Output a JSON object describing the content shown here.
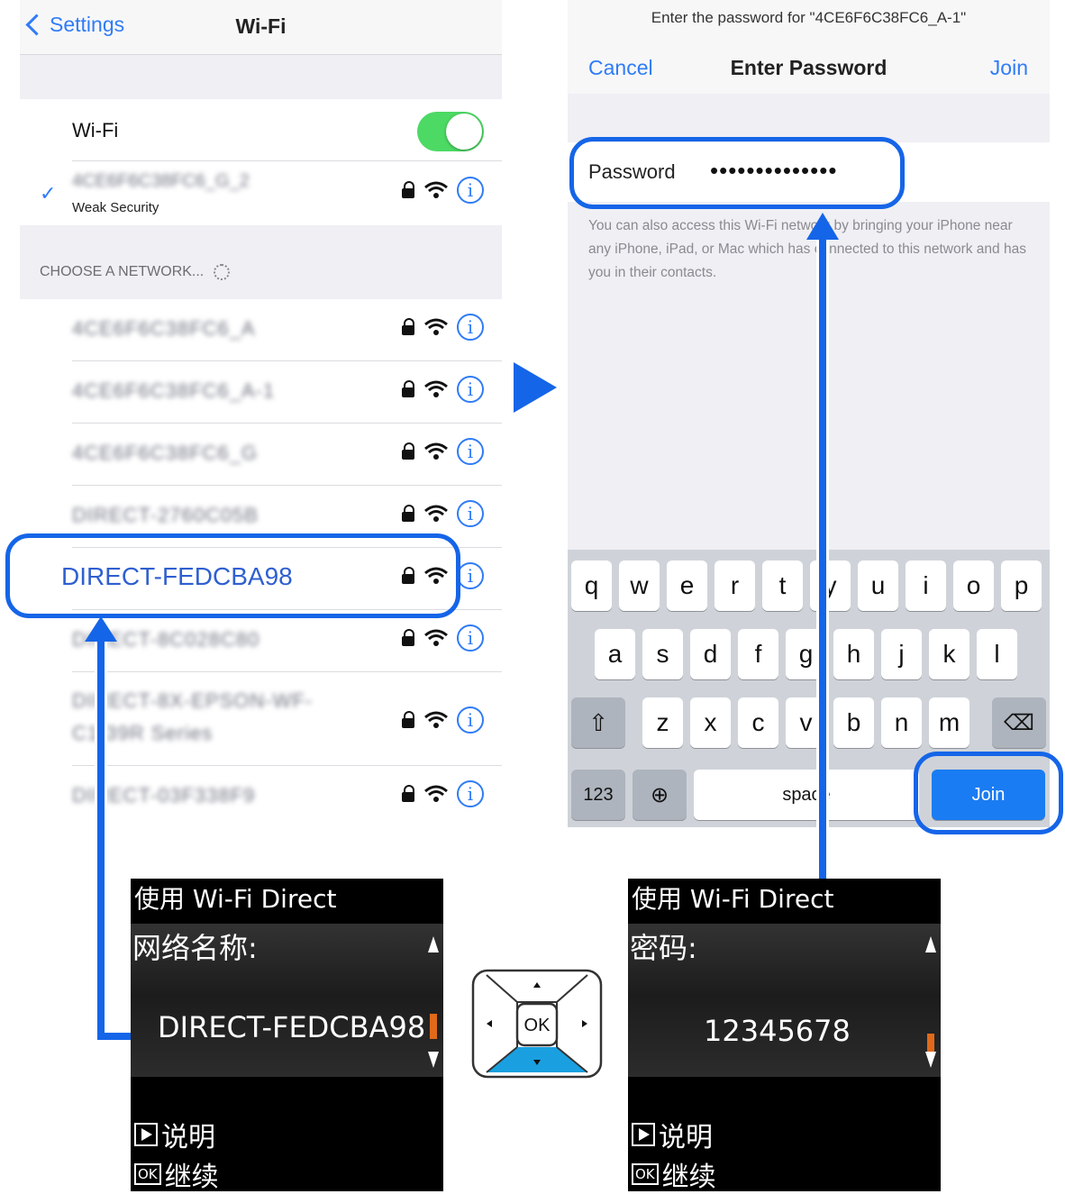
{
  "wifi_screen": {
    "back_label": "Settings",
    "title": "Wi-Fi",
    "wifi_toggle_label": "Wi-Fi",
    "wifi_enabled": true,
    "connected_network": {
      "name": "4CE6F6C38FC6_G_2",
      "security_note": "Weak Security"
    },
    "choose_header": "CHOOSE A NETWORK...",
    "networks": [
      {
        "name": "4CE6F6C38FC6_A"
      },
      {
        "name": "4CE6F6C38FC6_A-1"
      },
      {
        "name": "4CE6F6C38FC6_G"
      },
      {
        "name": "DIRECT-2760C05B"
      },
      {
        "name": "DIRECT-FEDCBA98"
      },
      {
        "name": "DIRECT-8C028C80"
      },
      {
        "name": "DIRECT-8X-EPSON-WF-C1 39R Series"
      },
      {
        "name": "DIRECT-03F338F9"
      }
    ],
    "highlighted_network": "DIRECT-FEDCBA98",
    "info_glyph": "i"
  },
  "password_screen": {
    "prompt": "Enter the password for \"4CE6F6C38FC6_A-1\"",
    "cancel_label": "Cancel",
    "title": "Enter Password",
    "join_label": "Join",
    "password_label": "Password",
    "password_mask": "••••••••••••••",
    "note": "You can also access this Wi-Fi network by bringing your iPhone near any iPhone, iPad, or Mac which has connected to this network and has you in their contacts."
  },
  "keyboard": {
    "row1": [
      "q",
      "w",
      "e",
      "r",
      "t",
      "y",
      "u",
      "i",
      "o",
      "p"
    ],
    "row2": [
      "a",
      "s",
      "d",
      "f",
      "g",
      "h",
      "j",
      "k",
      "l"
    ],
    "row3": [
      "z",
      "x",
      "c",
      "v",
      "b",
      "n",
      "m"
    ],
    "numbers_label": "123",
    "space_label": "space",
    "join_label": "Join"
  },
  "printer_lcd_network": {
    "title": "使用 Wi-Fi Direct",
    "label": "网络名称:",
    "value": "DIRECT-FEDCBA98",
    "help_label": "说明",
    "continue_label": "继续",
    "ok_label": "OK"
  },
  "printer_lcd_password": {
    "title": "使用 Wi-Fi Direct",
    "label": "密码:",
    "value": "12345678",
    "help_label": "说明",
    "continue_label": "继续",
    "ok_label": "OK"
  },
  "dpad": {
    "ok_label": "OK"
  },
  "colors": {
    "ios_blue": "#2f7cf6",
    "highlight_blue": "#1565e8",
    "toggle_green": "#4cd964",
    "dpad_down_cyan": "#1aa0e0"
  }
}
